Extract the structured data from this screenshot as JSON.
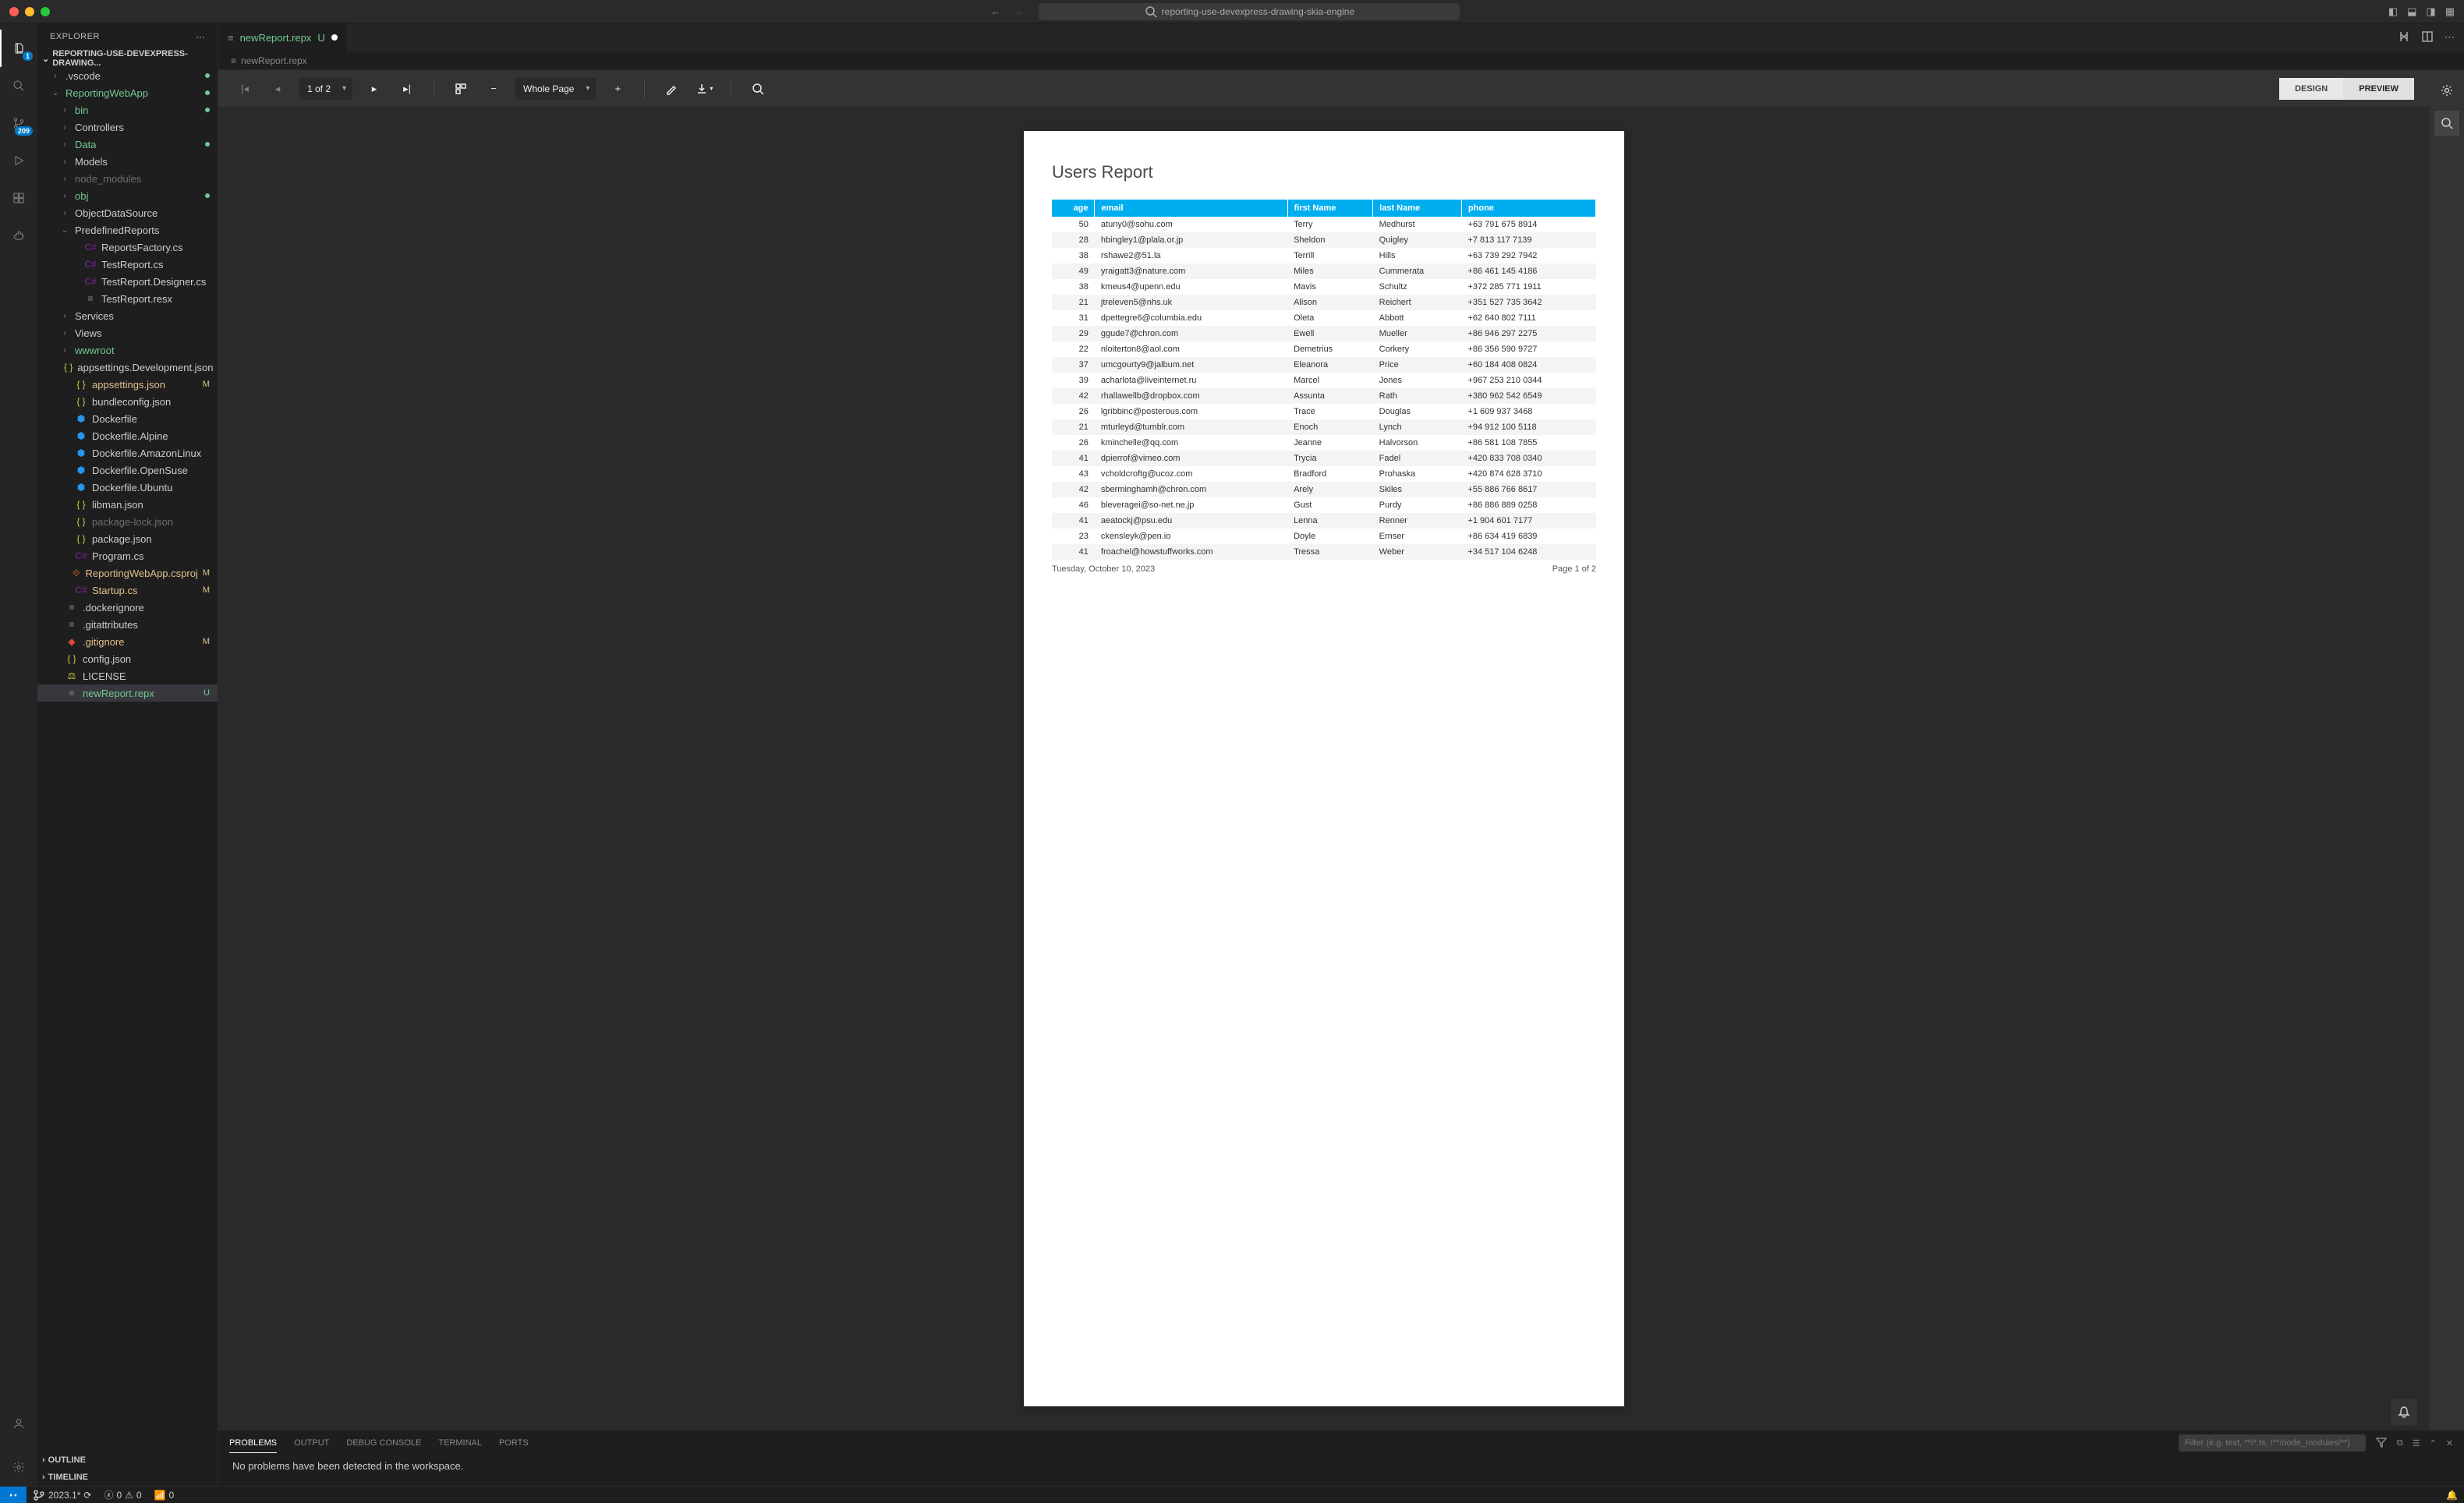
{
  "titlebar": {
    "search": "reporting-use-devexpress-drawing-skia-engine"
  },
  "activitybar": {
    "scm_badge": "209"
  },
  "sidebar": {
    "title": "EXPLORER",
    "section": "REPORTING-USE-DEVEXPRESS-DRAWING...",
    "outline": "OUTLINE",
    "timeline": "TIMELINE"
  },
  "tree": [
    {
      "label": ".vscode",
      "indent": 1,
      "twist": "›",
      "mod": "dotg"
    },
    {
      "label": "ReportingWebApp",
      "indent": 1,
      "twist": "⌄",
      "mod": "dotg",
      "cls": "untracked"
    },
    {
      "label": "bin",
      "indent": 2,
      "twist": "›",
      "mod": "dotg",
      "cls": "untracked"
    },
    {
      "label": "Controllers",
      "indent": 2,
      "twist": "›"
    },
    {
      "label": "Data",
      "indent": 2,
      "twist": "›",
      "mod": "dotg",
      "cls": "untracked"
    },
    {
      "label": "Models",
      "indent": 2,
      "twist": "›"
    },
    {
      "label": "node_modules",
      "indent": 2,
      "twist": "›",
      "cls": "dim"
    },
    {
      "label": "obj",
      "indent": 2,
      "twist": "›",
      "mod": "dotg",
      "cls": "untracked"
    },
    {
      "label": "ObjectDataSource",
      "indent": 2,
      "twist": "›"
    },
    {
      "label": "PredefinedReports",
      "indent": 2,
      "twist": "⌄"
    },
    {
      "label": "ReportsFactory.cs",
      "indent": 3,
      "icon": "cs"
    },
    {
      "label": "TestReport.cs",
      "indent": 3,
      "icon": "cs"
    },
    {
      "label": "TestReport.Designer.cs",
      "indent": 3,
      "icon": "cs"
    },
    {
      "label": "TestReport.resx",
      "indent": 3,
      "icon": "txt"
    },
    {
      "label": "Services",
      "indent": 2,
      "twist": "›"
    },
    {
      "label": "Views",
      "indent": 2,
      "twist": "›"
    },
    {
      "label": "wwwroot",
      "indent": 2,
      "twist": "›",
      "cls": "untracked"
    },
    {
      "label": "appsettings.Development.json",
      "indent": 2,
      "icon": "json"
    },
    {
      "label": "appsettings.json",
      "indent": 2,
      "icon": "json",
      "mod": "M",
      "cls": "modified"
    },
    {
      "label": "bundleconfig.json",
      "indent": 2,
      "icon": "json"
    },
    {
      "label": "Dockerfile",
      "indent": 2,
      "icon": "docker"
    },
    {
      "label": "Dockerfile.Alpine",
      "indent": 2,
      "icon": "docker"
    },
    {
      "label": "Dockerfile.AmazonLinux",
      "indent": 2,
      "icon": "docker"
    },
    {
      "label": "Dockerfile.OpenSuse",
      "indent": 2,
      "icon": "docker"
    },
    {
      "label": "Dockerfile.Ubuntu",
      "indent": 2,
      "icon": "docker"
    },
    {
      "label": "libman.json",
      "indent": 2,
      "icon": "json"
    },
    {
      "label": "package-lock.json",
      "indent": 2,
      "icon": "json",
      "cls": "dim"
    },
    {
      "label": "package.json",
      "indent": 2,
      "icon": "json"
    },
    {
      "label": "Program.cs",
      "indent": 2,
      "icon": "cs"
    },
    {
      "label": "ReportingWebApp.csproj",
      "indent": 2,
      "icon": "csproj",
      "mod": "M",
      "cls": "modified"
    },
    {
      "label": "Startup.cs",
      "indent": 2,
      "icon": "cs",
      "mod": "M",
      "cls": "modified"
    },
    {
      "label": ".dockerignore",
      "indent": 1,
      "icon": "txt"
    },
    {
      "label": ".gitattributes",
      "indent": 1,
      "icon": "txt"
    },
    {
      "label": ".gitignore",
      "indent": 1,
      "icon": "git",
      "mod": "M",
      "cls": "modified"
    },
    {
      "label": "config.json",
      "indent": 1,
      "icon": "json"
    },
    {
      "label": "LICENSE",
      "indent": 1,
      "icon": "lic"
    },
    {
      "label": "newReport.repx",
      "indent": 1,
      "icon": "txt",
      "mod": "U",
      "cls": "untracked",
      "selected": true
    }
  ],
  "editor": {
    "tab": "newReport.repx",
    "tab_status": "U",
    "breadcrumb": "newReport.repx"
  },
  "viewer": {
    "page_selector": "1 of 2",
    "zoom_selector": "Whole Page",
    "mode_design": "DESIGN",
    "mode_preview": "PREVIEW"
  },
  "report": {
    "title": "Users Report",
    "columns": [
      "age",
      "email",
      "first Name",
      "last Name",
      "phone"
    ],
    "rows": [
      [
        "50",
        "atuny0@sohu.com",
        "Terry",
        "Medhurst",
        "+63 791 675 8914"
      ],
      [
        "28",
        "hbingley1@plala.or.jp",
        "Sheldon",
        "Quigley",
        "+7 813 117 7139"
      ],
      [
        "38",
        "rshawe2@51.la",
        "Terrill",
        "Hills",
        "+63 739 292 7942"
      ],
      [
        "49",
        "yraigatt3@nature.com",
        "Miles",
        "Cummerata",
        "+86 461 145 4186"
      ],
      [
        "38",
        "kmeus4@upenn.edu",
        "Mavis",
        "Schultz",
        "+372 285 771 1911"
      ],
      [
        "21",
        "jtreleven5@nhs.uk",
        "Alison",
        "Reichert",
        "+351 527 735 3642"
      ],
      [
        "31",
        "dpettegre6@columbia.edu",
        "Oleta",
        "Abbott",
        "+62 640 802 7111"
      ],
      [
        "29",
        "ggude7@chron.com",
        "Ewell",
        "Mueller",
        "+86 946 297 2275"
      ],
      [
        "22",
        "nloiterton8@aol.com",
        "Demetrius",
        "Corkery",
        "+86 356 590 9727"
      ],
      [
        "37",
        "umcgourty9@jalbum.net",
        "Eleanora",
        "Price",
        "+60 184 408 0824"
      ],
      [
        "39",
        "acharlota@liveinternet.ru",
        "Marcel",
        "Jones",
        "+967 253 210 0344"
      ],
      [
        "42",
        "rhallawellb@dropbox.com",
        "Assunta",
        "Rath",
        "+380 962 542 6549"
      ],
      [
        "26",
        "lgribbinc@posterous.com",
        "Trace",
        "Douglas",
        "+1 609 937 3468"
      ],
      [
        "21",
        "mturleyd@tumblr.com",
        "Enoch",
        "Lynch",
        "+94 912 100 5118"
      ],
      [
        "26",
        "kminchelle@qq.com",
        "Jeanne",
        "Halvorson",
        "+86 581 108 7855"
      ],
      [
        "41",
        "dpierrof@vimeo.com",
        "Trycia",
        "Fadel",
        "+420 833 708 0340"
      ],
      [
        "43",
        "vcholdcroftg@ucoz.com",
        "Bradford",
        "Prohaska",
        "+420 874 628 3710"
      ],
      [
        "42",
        "sberminghamh@chron.com",
        "Arely",
        "Skiles",
        "+55 886 766 8617"
      ],
      [
        "46",
        "bleveragei@so-net.ne.jp",
        "Gust",
        "Purdy",
        "+86 886 889 0258"
      ],
      [
        "41",
        "aeatockj@psu.edu",
        "Lenna",
        "Renner",
        "+1 904 601 7177"
      ],
      [
        "23",
        "ckensleyk@pen.io",
        "Doyle",
        "Ernser",
        "+86 634 419 6839"
      ],
      [
        "41",
        "froachel@howstuffworks.com",
        "Tressa",
        "Weber",
        "+34 517 104 6248"
      ]
    ],
    "footer_date": "Tuesday, October 10, 2023",
    "footer_page": "Page 1 of 2"
  },
  "panel": {
    "tabs": [
      "PROBLEMS",
      "OUTPUT",
      "DEBUG CONSOLE",
      "TERMINAL",
      "PORTS"
    ],
    "filter_placeholder": "Filter (e.g. text, **/*.ts, !**/node_modules/**)",
    "message": "No problems have been detected in the workspace."
  },
  "statusbar": {
    "branch": "2023.1*",
    "errors": "0",
    "warnings": "0",
    "ports": "0"
  }
}
